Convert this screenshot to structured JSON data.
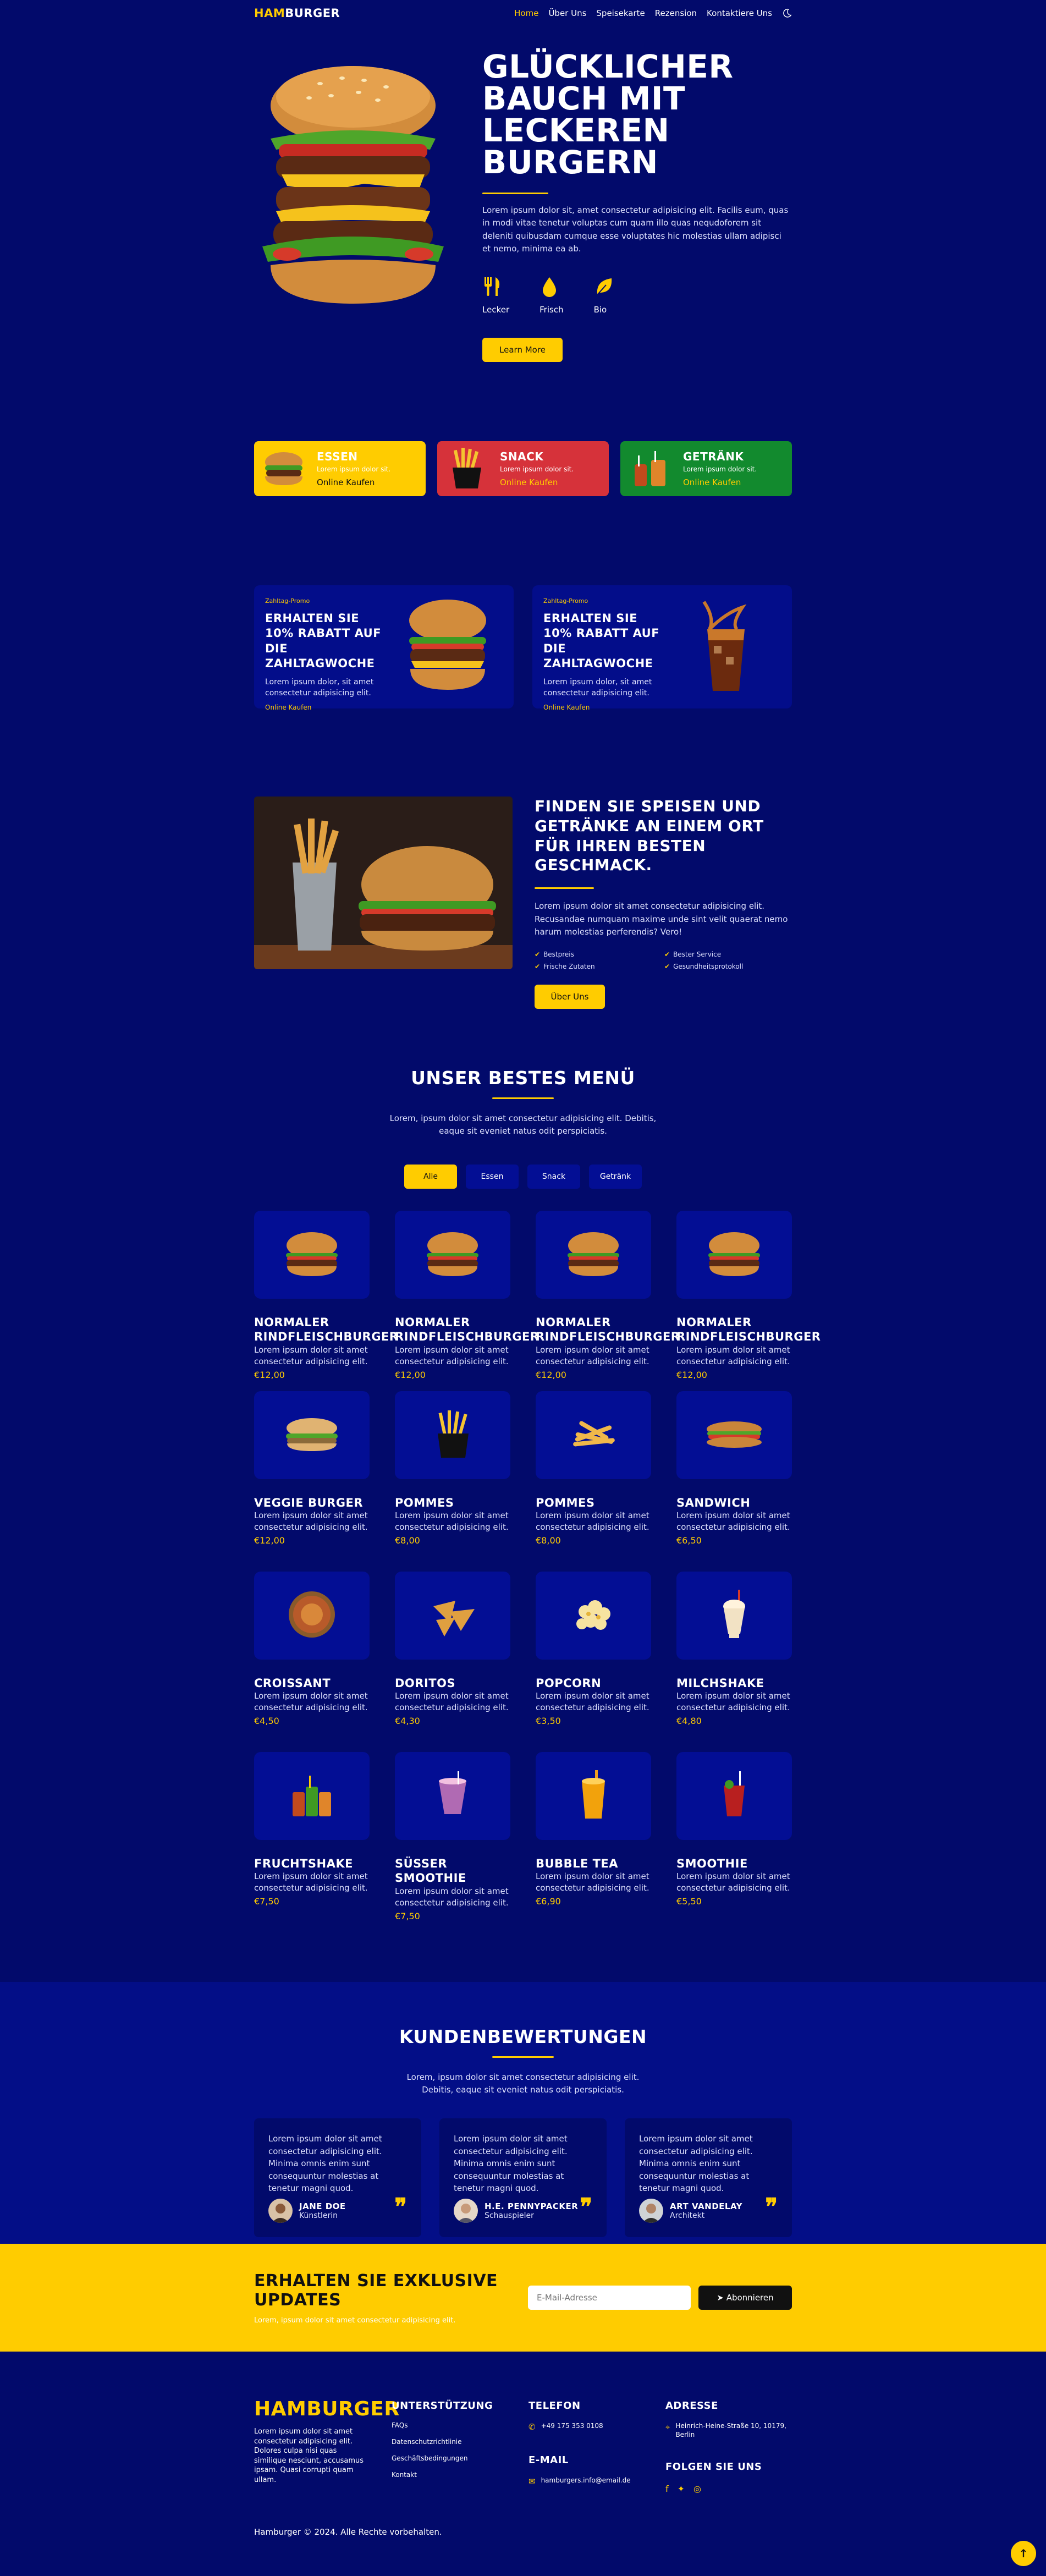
{
  "header": {
    "logo_part1": "HAM",
    "logo_part2": "BURGER",
    "nav": [
      "Home",
      "Über Uns",
      "Speisekarte",
      "Rezension",
      "Kontaktiere Uns"
    ]
  },
  "hero": {
    "title": "GLÜCKLICHER BAUCH MIT LECKEREN BURGERN",
    "desc": "Lorem ipsum dolor sit, amet consectetur adipisicing elit. Facilis eum, quas in modi vitae tenetur voluptas cum quam illo quas nequdoforem sit deleniti quibusdam cumque esse voluptates hic molestias ullam adipisci et nemo, minima ea ab.",
    "features": [
      "Lecker",
      "Frisch",
      "Bio"
    ],
    "button": "Learn More"
  },
  "categories": [
    {
      "title": "ESSEN",
      "sub": "Lorem ipsum dolor sit.",
      "link": "Online Kaufen",
      "color": "#ffcc00"
    },
    {
      "title": "SNACK",
      "sub": "Lorem ipsum dolor sit.",
      "link": "Online Kaufen",
      "color": "#d6323a"
    },
    {
      "title": "GETRÄNK",
      "sub": "Lorem ipsum dolor sit.",
      "link": "Online Kaufen",
      "color": "#128a2e"
    }
  ],
  "promos": [
    {
      "tag": "Zahltag-Promo",
      "title": "ERHALTEN SIE 10% RABATT AUF DIE ZAHLTAGWOCHE",
      "desc": "Lorem ipsum dolor, sit amet consectetur adipisicing elit.",
      "link": "Online Kaufen"
    },
    {
      "tag": "Zahltag-Promo",
      "title": "ERHALTEN SIE 10% RABATT AUF DIE ZAHLTAGWOCHE",
      "desc": "Lorem ipsum dolor, sit amet consectetur adipisicing elit.",
      "link": "Online Kaufen"
    }
  ],
  "about": {
    "title": "FINDEN SIE SPEISEN UND GETRÄNKE AN EINEM ORT FÜR IHREN BESTEN GESCHMACK.",
    "desc": "Lorem ipsum dolor sit amet consectetur adipisicing elit. Recusandae numquam maxime unde sint velit quaerat nemo harum molestias perferendis? Vero!",
    "checks": [
      "Bestpreis",
      "Bester Service",
      "Frische Zutaten",
      "Gesundheitsprotokoll"
    ],
    "button": "Über Uns"
  },
  "menu": {
    "title": "UNSER BESTES MENÜ",
    "desc": "Lorem, ipsum dolor sit amet consectetur adipisicing elit. Debitis, eaque sit eveniet natus odit perspiciatis.",
    "filters": [
      "Alle",
      "Essen",
      "Snack",
      "Getränk"
    ],
    "items": [
      {
        "name": "NORMALER RINDFLEISCHBURGER",
        "desc": "Lorem ipsum dolor sit amet consectetur adipisicing elit.",
        "price": "€12,00",
        "icon": "burger-icon"
      },
      {
        "name": "NORMALER RINDFLEISCHBURGER",
        "desc": "Lorem ipsum dolor sit amet consectetur adipisicing elit.",
        "price": "€12,00",
        "icon": "burger-icon"
      },
      {
        "name": "NORMALER RINDFLEISCHBURGER",
        "desc": "Lorem ipsum dolor sit amet consectetur adipisicing elit.",
        "price": "€12,00",
        "icon": "burger-icon"
      },
      {
        "name": "NORMALER RINDFLEISCHBURGER",
        "desc": "Lorem ipsum dolor sit amet consectetur adipisicing elit.",
        "price": "€12,00",
        "icon": "burger-icon"
      },
      {
        "name": "VEGGIE BURGER",
        "desc": "Lorem ipsum dolor sit amet consectetur adipisicing elit.",
        "price": "€12,00",
        "icon": "veggie-burger-icon"
      },
      {
        "name": "POMMES",
        "desc": "Lorem ipsum dolor sit amet consectetur adipisicing elit.",
        "price": "€8,00",
        "icon": "fries-icon"
      },
      {
        "name": "POMMES",
        "desc": "Lorem ipsum dolor sit amet consectetur adipisicing elit.",
        "price": "€8,00",
        "icon": "fries-bowl-icon"
      },
      {
        "name": "SANDWICH",
        "desc": "Lorem ipsum dolor sit amet consectetur adipisicing elit.",
        "price": "€6,50",
        "icon": "sandwich-icon"
      },
      {
        "name": "CROISSANT",
        "desc": "Lorem ipsum dolor sit amet consectetur adipisicing elit.",
        "price": "€4,50",
        "icon": "croissant-icon"
      },
      {
        "name": "DORITOS",
        "desc": "Lorem ipsum dolor sit amet consectetur adipisicing elit.",
        "price": "€4,30",
        "icon": "chips-icon"
      },
      {
        "name": "POPCORN",
        "desc": "Lorem ipsum dolor sit amet consectetur adipisicing elit.",
        "price": "€3,50",
        "icon": "popcorn-icon"
      },
      {
        "name": "MILCHSHAKE",
        "desc": "Lorem ipsum dolor sit amet consectetur adipisicing elit.",
        "price": "€4,80",
        "icon": "milkshake-icon"
      },
      {
        "name": "FRUCHTSHAKE",
        "desc": "Lorem ipsum dolor sit amet consectetur adipisicing elit.",
        "price": "€7,50",
        "icon": "fruit-shake-icon"
      },
      {
        "name": "SÜSSER SMOOTHIE",
        "desc": "Lorem ipsum dolor sit amet consectetur adipisicing elit.",
        "price": "€7,50",
        "icon": "smoothie-icon"
      },
      {
        "name": "BUBBLE TEA",
        "desc": "Lorem ipsum dolor sit amet consectetur adipisicing elit.",
        "price": "€6,90",
        "icon": "bubble-tea-icon"
      },
      {
        "name": "SMOOTHIE",
        "desc": "Lorem ipsum dolor sit amet consectetur adipisicing elit.",
        "price": "€5,50",
        "icon": "red-smoothie-icon"
      }
    ]
  },
  "reviews": {
    "title": "KUNDENBEWERTUNGEN",
    "desc": "Lorem, ipsum dolor sit amet consectetur adipisicing elit. Debitis, eaque sit eveniet natus odit perspiciatis.",
    "items": [
      {
        "text": "Lorem ipsum dolor sit amet consectetur adipisicing elit. Minima omnis enim sunt consequuntur molestias at tenetur magni quod.",
        "name": "JANE DOE",
        "role": "Künstlerin"
      },
      {
        "text": "Lorem ipsum dolor sit amet consectetur adipisicing elit. Minima omnis enim sunt consequuntur molestias at tenetur magni quod.",
        "name": "H.E. PENNYPACKER",
        "role": "Schauspieler"
      },
      {
        "text": "Lorem ipsum dolor sit amet consectetur adipisicing elit. Minima omnis enim sunt consequuntur molestias at tenetur magni quod.",
        "name": "ART VANDELAY",
        "role": "Architekt"
      }
    ]
  },
  "newsletter": {
    "title": "ERHALTEN SIE EXKLUSIVE UPDATES",
    "sub": "Lorem, ipsum dolor sit amet consectetur adipisicing elit.",
    "placeholder": "E-Mail-Adresse",
    "button": "Abonnieren"
  },
  "footer": {
    "desc": "Lorem ipsum dolor sit amet consectetur adipisicing elit. Dolores culpa nisi quas similique nesciunt, accusamus ipsam. Quasi corrupti quam ullam.",
    "support_title": "UNTERSTÜTZUNG",
    "support_links": [
      "FAQs",
      "Datenschutzrichtlinie",
      "Geschäftsbedingungen",
      "Kontakt"
    ],
    "phone_title": "TELEFON",
    "phone": "+49 175 353 0108",
    "email_title": "E-MAIL",
    "email": "hamburgers.info@email.de",
    "address_title": "ADRESSE",
    "address": "Heinrich-Heine-Straße 10, 10179, Berlin",
    "social_title": "FOLGEN SIE UNS",
    "copyright": "Hamburger © 2024. Alle Rechte vorbehalten."
  },
  "colors": {
    "accent": "#ffcc00",
    "background": "#020a6b",
    "card": "#030e94"
  }
}
